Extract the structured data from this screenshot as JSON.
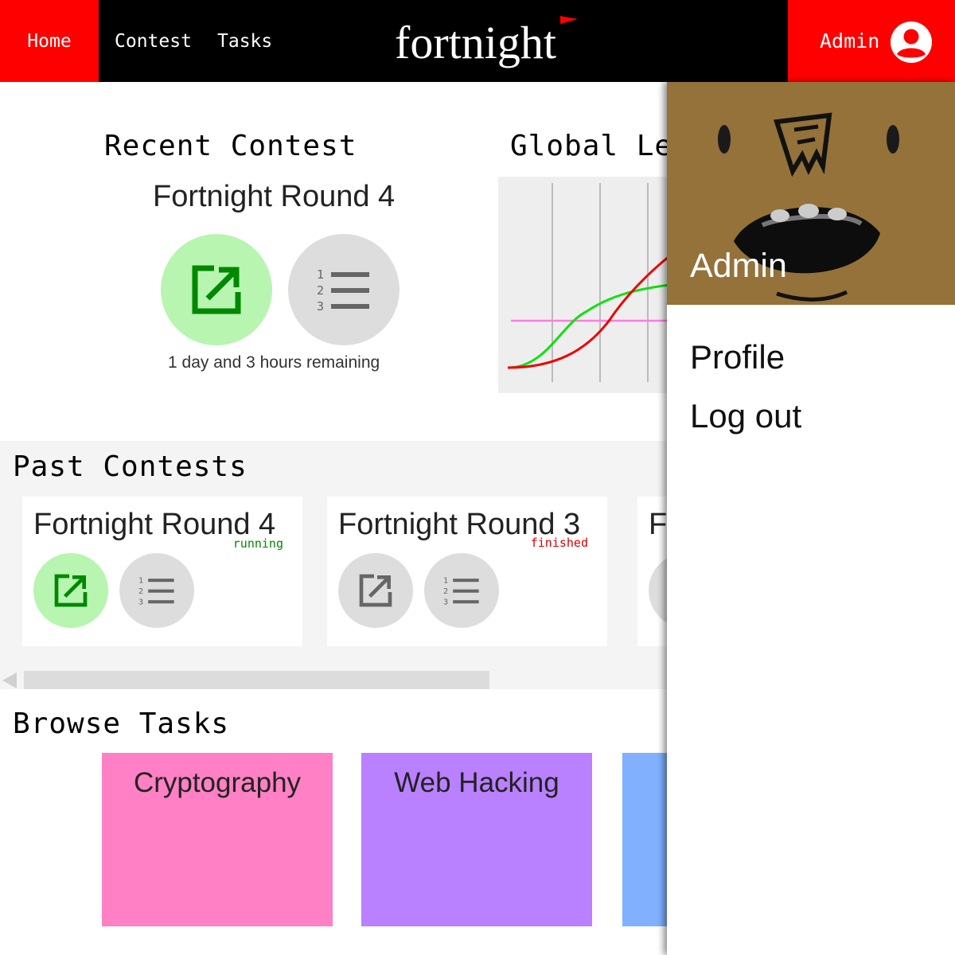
{
  "nav": {
    "home": "Home",
    "contest": "Contest",
    "tasks": "Tasks",
    "logo": "fortnight",
    "user": "Admin",
    "accent": "#ff0000"
  },
  "recent": {
    "heading": "Recent Contest",
    "contest_name": "Fortnight Round 4",
    "remaining": "1 day and 3 hours remaining",
    "open_icon": "open-in-new-icon",
    "ranking_icon": "ranking-list-icon"
  },
  "leaderboard": {
    "heading": "Global Le"
  },
  "past": {
    "heading": "Past Contests",
    "cards": [
      {
        "name": "Fortnight Round 4",
        "status": "running",
        "status_color": "#008800"
      },
      {
        "name": "Fortnight Round 3",
        "status": "finished",
        "status_color": "#dd0000"
      },
      {
        "name": "F"
      }
    ]
  },
  "browse": {
    "heading": "Browse Tasks",
    "tasks": [
      {
        "name": "Cryptography",
        "color": "#ff80c4"
      },
      {
        "name": "Web Hacking",
        "color": "#b980ff"
      },
      {
        "name": "",
        "color": "#80b0ff"
      }
    ]
  },
  "menu": {
    "name": "Admin",
    "items": [
      "Profile",
      "Log out"
    ]
  }
}
